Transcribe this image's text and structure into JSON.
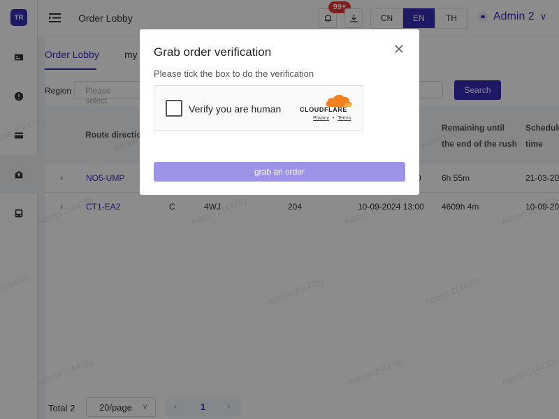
{
  "brand": {
    "logo_text": "TR"
  },
  "header": {
    "title": "Order Lobby",
    "notifications_badge": "99+",
    "languages": [
      "CN",
      "EN",
      "TH"
    ],
    "active_language": "EN",
    "user_name": "Admin 2"
  },
  "tabs": [
    {
      "label": "Order Lobby"
    },
    {
      "label": "my"
    }
  ],
  "filters": {
    "region_label": "Region",
    "region_placeholder": "Please select",
    "search_label": "Search"
  },
  "table": {
    "headers": {
      "route": "Route direction",
      "remaining": "Remaining until the end of the rush",
      "scheduled": "Schedule time"
    },
    "rows": [
      {
        "route": "NO5-UMP",
        "col2": "",
        "col3": "",
        "col4": "",
        "col5": "0",
        "remaining": "6h 55m",
        "scheduled": "21-03-20"
      },
      {
        "route": "CT1-EA2",
        "col2": "C",
        "col3": "4WJ",
        "col4": "204",
        "col5": "10-09-2024 13:00",
        "remaining": "4609h 4m",
        "scheduled": "10-09-20"
      }
    ]
  },
  "pagination": {
    "total": "Total 2",
    "page_size": "20/page",
    "current_page": "1"
  },
  "watermark": "Admin 2(4478)",
  "modal": {
    "title": "Grab order verification",
    "description": "Please tick the box to do the verification",
    "captcha_label": "Verify you are human",
    "captcha_brand": "CLOUDFLARE",
    "privacy_link": "Privacy",
    "separator": "•",
    "terms_link": "Terms",
    "grab_button": "grab an order"
  },
  "colors": {
    "accent": "#3a2fb8",
    "grab_button": "#9d93e8",
    "badge": "#e53935",
    "cloudflare_orange": "#f48120"
  }
}
